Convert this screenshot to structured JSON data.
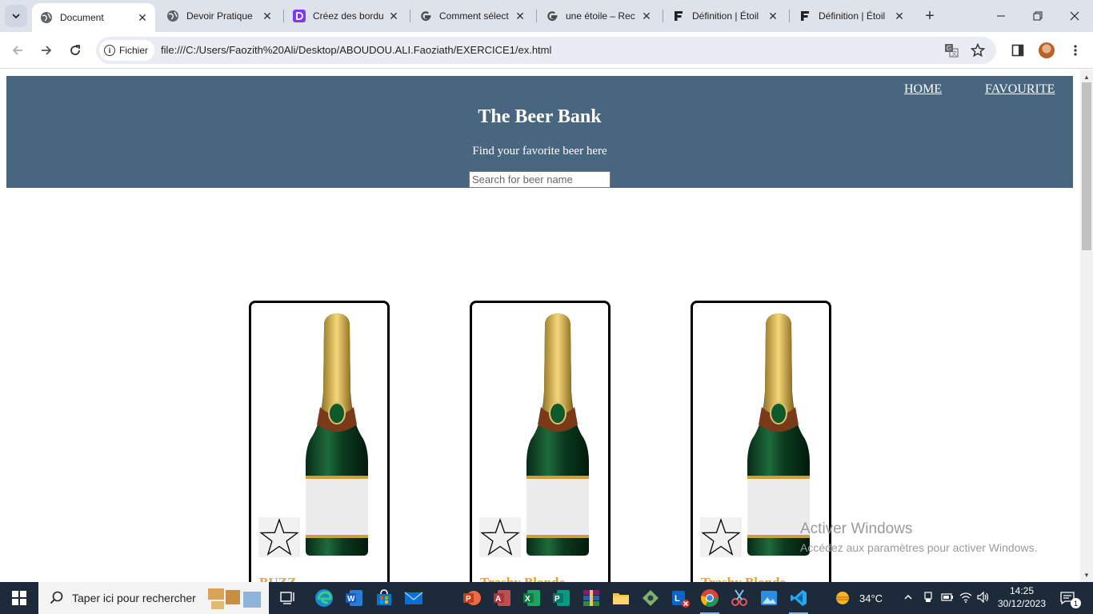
{
  "browser": {
    "tabs": [
      {
        "title": "Document",
        "favicon": "globe-icon",
        "active": true
      },
      {
        "title": "Devoir Pratique",
        "favicon": "globe-icon",
        "active": false
      },
      {
        "title": "Créez des bordu",
        "favicon": "d-logo-icon",
        "active": false
      },
      {
        "title": "Comment sélect",
        "favicon": "google-icon",
        "active": false
      },
      {
        "title": "une étoile – Rec",
        "favicon": "google-icon",
        "active": false
      },
      {
        "title": "Définition | Étoil",
        "favicon": "f-logo-icon",
        "active": false
      },
      {
        "title": "Définition | Étoil",
        "favicon": "f-logo-icon",
        "active": false
      }
    ],
    "site_info_label": "Fichier",
    "url": "file:///C:/Users/Faozith%20Ali/Desktop/ABOUDOU.ALI.Faoziath/EXERCICE1/ex.html"
  },
  "page": {
    "nav": {
      "home": "HOME",
      "favourite": "FAVOURITE"
    },
    "title": "The Beer Bank",
    "tagline": "Find your favorite beer here",
    "search_placeholder": "Search for beer name",
    "cards": [
      {
        "name": "BUZZ"
      },
      {
        "name": "Trashy Blonde"
      },
      {
        "name": "Trashy Blonde"
      }
    ]
  },
  "windows_watermark": {
    "title": "Activer Windows",
    "subtitle": "Accédez aux paramètres pour activer Windows."
  },
  "taskbar": {
    "search_placeholder": "Taper ici pour rechercher",
    "weather": "34°C",
    "time": "14:25",
    "date": "30/12/2023",
    "notification_count": "1"
  },
  "colors": {
    "header_bg": "#486680",
    "beer_name": "#f0a020",
    "taskbar_bg": "#1c2a3a"
  }
}
